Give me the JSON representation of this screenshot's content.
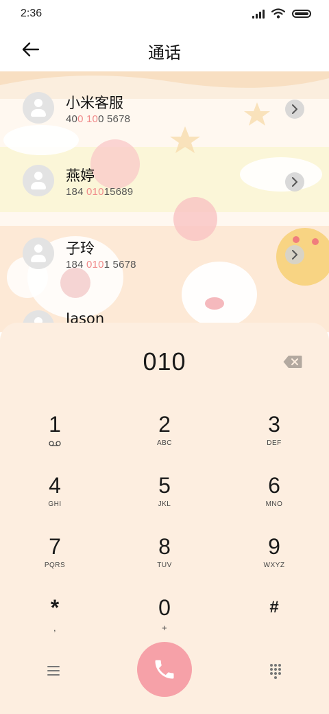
{
  "status_bar": {
    "time": "2:36"
  },
  "header": {
    "title": "通话"
  },
  "contacts": [
    {
      "name": "小米客服",
      "number_parts": [
        "40",
        "0 ",
        "10",
        "0 5678"
      ]
    },
    {
      "name": "燕婷",
      "number_parts": [
        "184 ",
        "010",
        "15689",
        ""
      ]
    },
    {
      "name": "子玲",
      "number_parts": [
        "184 ",
        "010",
        "1 5678",
        ""
      ]
    },
    {
      "name": "Jason",
      "number_parts": [
        "",
        "",
        "",
        ""
      ]
    }
  ],
  "dialpad": {
    "number": "010",
    "keys": [
      {
        "digit": "1",
        "letters": ""
      },
      {
        "digit": "2",
        "letters": "ABC"
      },
      {
        "digit": "3",
        "letters": "DEF"
      },
      {
        "digit": "4",
        "letters": "GHI"
      },
      {
        "digit": "5",
        "letters": "JKL"
      },
      {
        "digit": "6",
        "letters": "MNO"
      },
      {
        "digit": "7",
        "letters": "PQRS"
      },
      {
        "digit": "8",
        "letters": "TUV"
      },
      {
        "digit": "9",
        "letters": "WXYZ"
      },
      {
        "digit": "*",
        "letters": ","
      },
      {
        "digit": "0",
        "letters": "+"
      },
      {
        "digit": "#",
        "letters": ""
      }
    ]
  },
  "colors": {
    "accent_highlight": "#f08a8a",
    "call_button": "#f6a1a8",
    "dialpad_bg": "#fdeee0"
  },
  "icons": [
    "signal-icon",
    "wifi-icon",
    "battery-icon",
    "back-arrow-icon",
    "chevron-right-icon",
    "voicemail-icon",
    "backspace-icon",
    "menu-icon",
    "phone-icon",
    "keypad-icon"
  ]
}
